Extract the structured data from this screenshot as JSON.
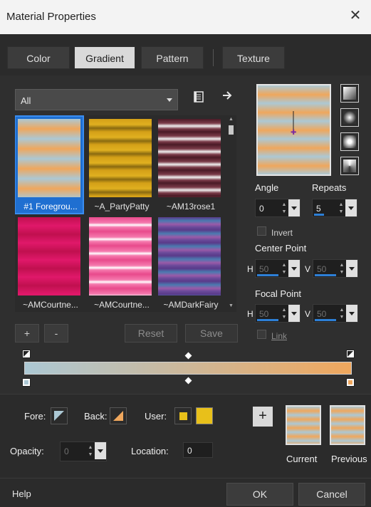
{
  "window": {
    "title": "Material Properties",
    "close_glyph": "✕"
  },
  "tabs": [
    {
      "label": "Color",
      "active": false
    },
    {
      "label": "Gradient",
      "active": true
    },
    {
      "label": "Pattern",
      "active": false
    },
    {
      "label": "Texture",
      "active": false
    }
  ],
  "filter": {
    "value": "All"
  },
  "toolbar_icons": {
    "library": "book-icon",
    "more": "arrow-right-icon"
  },
  "swatches": [
    {
      "label": "#1 Foregrou...",
      "selected": true,
      "style": "peach-blue"
    },
    {
      "label": "~A_PartyPatty",
      "selected": false,
      "style": "gold"
    },
    {
      "label": "~AM13rose1",
      "selected": false,
      "style": "maroon"
    },
    {
      "label": "~AMCourtne...",
      "selected": false,
      "style": "magenta"
    },
    {
      "label": "~AMCourtne...",
      "selected": false,
      "style": "pink"
    },
    {
      "label": "~AMDarkFairy",
      "selected": false,
      "style": "purple"
    }
  ],
  "list_buttons": {
    "add": "+",
    "remove": "-",
    "reset": "Reset",
    "save": "Save"
  },
  "angle": {
    "label": "Angle",
    "value": "0"
  },
  "repeats": {
    "label": "Repeats",
    "value": "5"
  },
  "invert": {
    "label": "Invert",
    "checked": false
  },
  "center_point": {
    "label": "Center Point",
    "h_label": "H",
    "h_value": "50",
    "v_label": "V",
    "v_value": "50"
  },
  "focal_point": {
    "label": "Focal Point",
    "h_label": "H",
    "h_value": "50",
    "v_label": "V",
    "v_value": "50"
  },
  "link": {
    "label": "Link",
    "checked": false
  },
  "fore": {
    "label": "Fore:"
  },
  "back": {
    "label": "Back:"
  },
  "user": {
    "label": "User:"
  },
  "opacity": {
    "label": "Opacity:",
    "value": "0"
  },
  "location": {
    "label": "Location:",
    "value": "0"
  },
  "add_glyph": "+",
  "current": {
    "label": "Current"
  },
  "previous": {
    "label": "Previous"
  },
  "footer": {
    "help": "Help",
    "ok": "OK",
    "cancel": "Cancel"
  },
  "colors": {
    "peach": "#efa75d",
    "light_blue": "#acc8d4",
    "gold": "#d4a017",
    "maroon": "#5a1e2a",
    "magenta": "#d0145c",
    "pink": "#e84a8c",
    "purple": "#6a4a9a",
    "user_yellow": "#e8c01a",
    "selection_blue": "#1f6fd1"
  }
}
